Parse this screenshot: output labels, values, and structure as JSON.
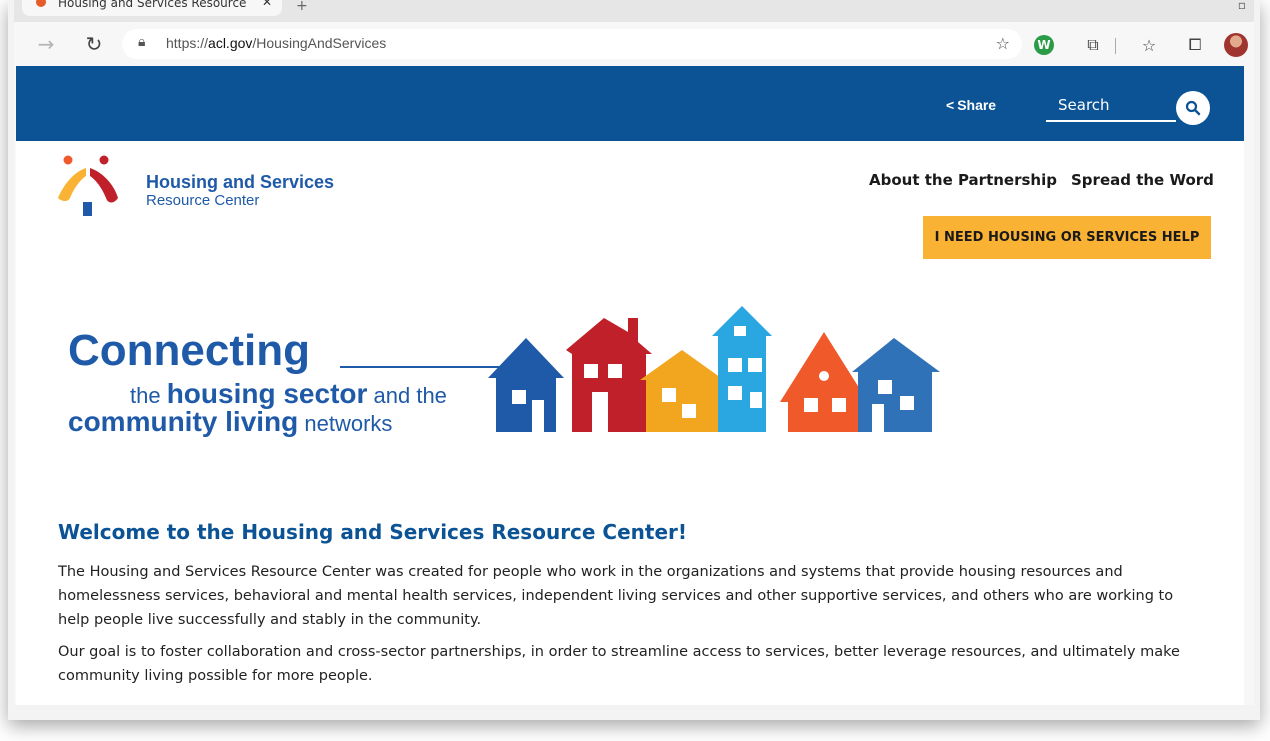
{
  "browser": {
    "tab_title": "Housing and Services Resource",
    "tab_close": "✕",
    "new_tab": "+",
    "url_prefix": "https://",
    "url_domain": "acl.gov",
    "url_path": "/HousingAndServices",
    "extension_w": "W"
  },
  "site": {
    "topbar_color": "#0b5394",
    "share_label": "Share",
    "search_placeholder": "Search",
    "logo_title": "Housing and Services",
    "logo_subtitle": "Resource Center",
    "nav": {
      "about": "About the Partnership",
      "spread": "Spread the Word"
    },
    "help_button": "I NEED HOUSING OR SERVICES HELP",
    "help_button_color": "#f9b233",
    "hero": {
      "connecting": "Connecting",
      "line2_the": "the ",
      "line2_big": "housing sector",
      "line2_rest": " and the",
      "line3_big": "community living",
      "line3_rest": " networks",
      "house_colors": [
        "#1f5aa8",
        "#c0202a",
        "#f2a620",
        "#2aa6e0",
        "#f05a2a",
        "#2f72b8"
      ]
    },
    "welcome_heading": "Welcome to the Housing and Services Resource Center!",
    "paragraph1": "The Housing and Services Resource Center was created for people who work in the organizations and systems that provide housing resources and homelessness services, behavioral and mental health services, independent living services and other supportive services, and others who are working to help people live successfully and stably in the community.",
    "paragraph2": "Our goal is to foster collaboration and cross-sector partnerships, in order to streamline access to services, better leverage resources, and ultimately make community living possible for more people."
  }
}
